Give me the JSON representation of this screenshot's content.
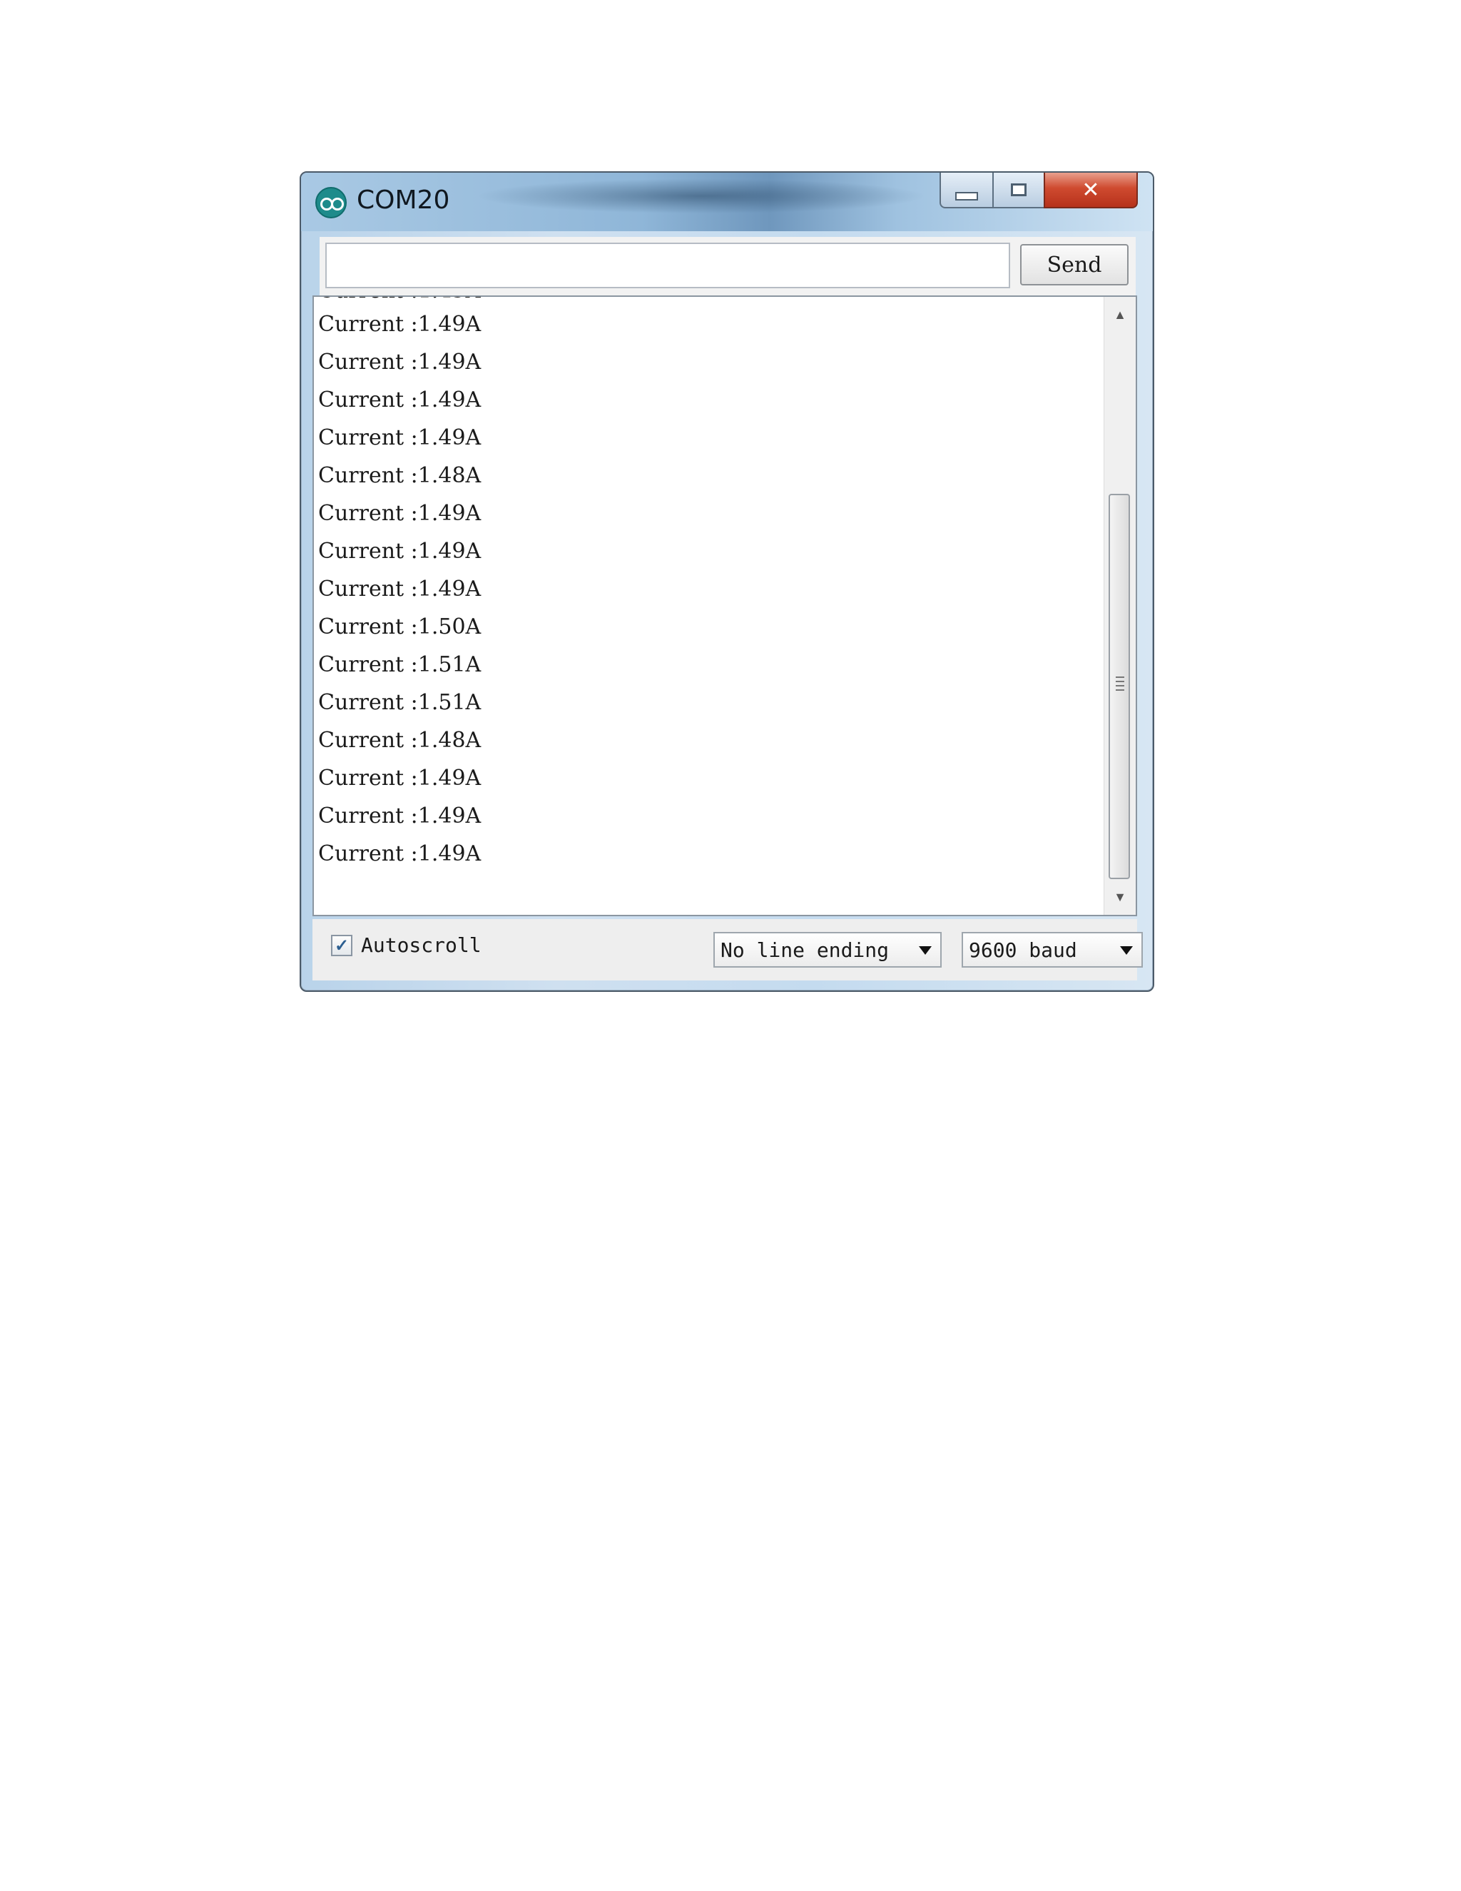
{
  "window": {
    "title": "COM20"
  },
  "send_bar": {
    "input_value": "",
    "send_label": "Send"
  },
  "output": {
    "lines": [
      "Current :1.49A",
      "Current :1.49A",
      "Current :1.49A",
      "Current :1.49A",
      "Current :1.48A",
      "Current :1.49A",
      "Current :1.49A",
      "Current :1.49A",
      "Current :1.50A",
      "Current :1.51A",
      "Current :1.51A",
      "Current :1.48A",
      "Current :1.49A",
      "Current :1.49A",
      "Current :1.49A"
    ]
  },
  "bottom_bar": {
    "autoscroll_label": "Autoscroll",
    "autoscroll_checked": true,
    "line_ending": "No line ending",
    "baud_rate": "9600 baud"
  },
  "icons": {
    "app": "arduino-icon",
    "minimize": "minimize-icon",
    "maximize": "maximize-icon",
    "close": "close-icon",
    "dropdown": "chevron-down-icon"
  },
  "colors": {
    "close_button": "#cf4a2f",
    "titlebar": "#8fb6d8"
  }
}
